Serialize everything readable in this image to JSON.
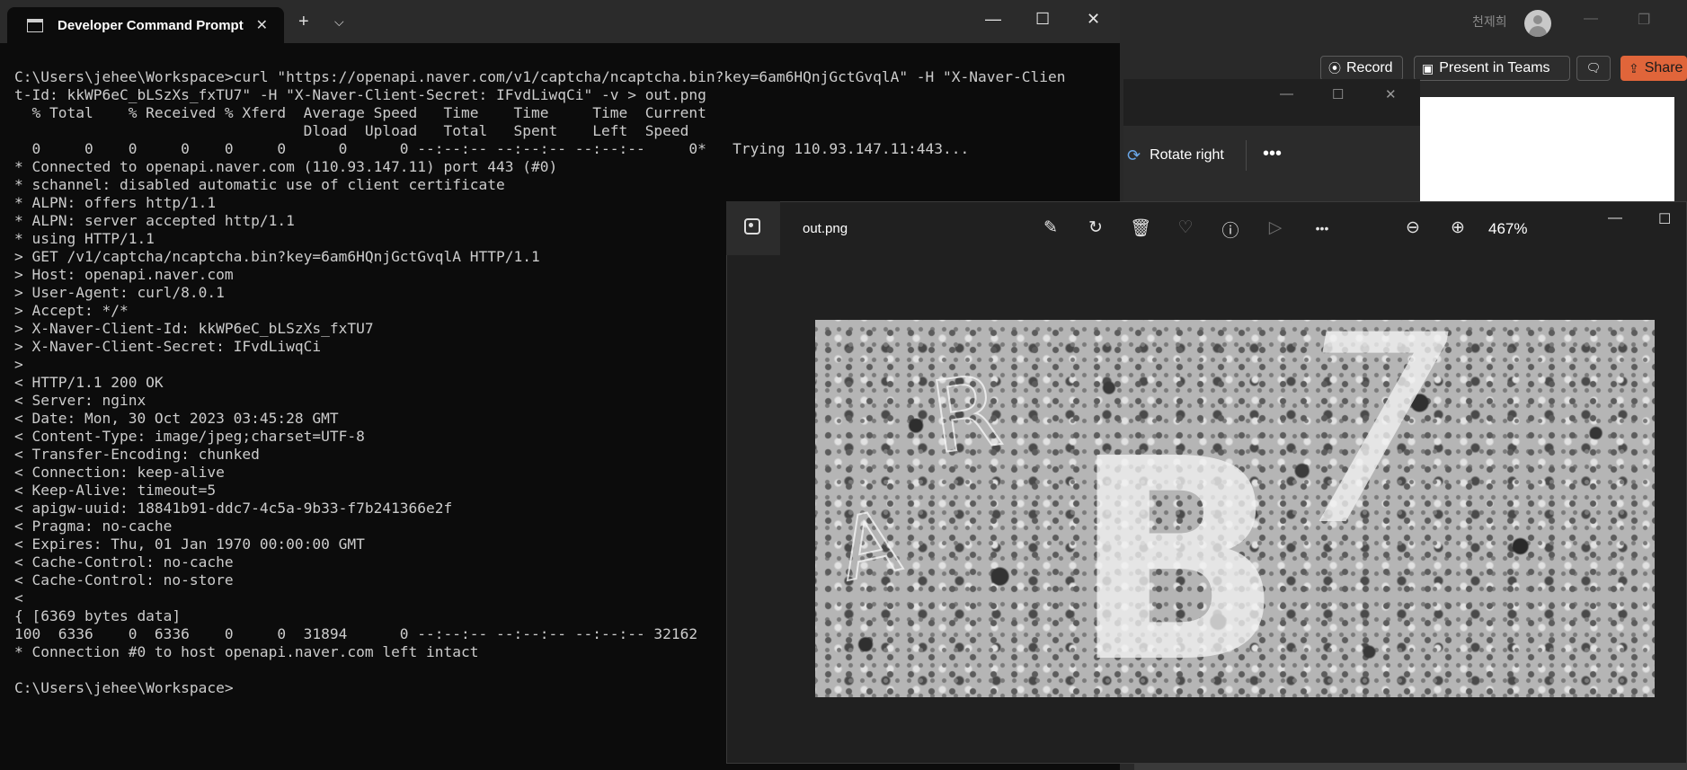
{
  "background_app": {
    "user_name": "천제희",
    "minimize_glyph": "—",
    "restore_glyph": "❐",
    "buttons": [
      {
        "icon": "record-icon",
        "glyph": "⦿",
        "label": "Record"
      },
      {
        "icon": "teams-present-icon",
        "glyph": "▣",
        "label": "Present in Teams"
      },
      {
        "icon": "comment-icon",
        "glyph": "🗨",
        "label": ""
      },
      {
        "icon": "share-icon",
        "glyph": "⇪",
        "label": "Share"
      }
    ]
  },
  "edit_window": {
    "rotate_label": "Rotate right",
    "rotate_glyph": "⟳",
    "more_glyph": "•••",
    "minimize_glyph": "—",
    "maximize_glyph": "☐",
    "close_glyph": "✕"
  },
  "terminal": {
    "tab_title": "Developer Command Prompt",
    "tab_close": "✕",
    "new_tab": "+",
    "dropdown": "⌵",
    "minimize_glyph": "—",
    "maximize_glyph": "☐",
    "close_glyph": "✕",
    "lines": [
      "C:\\Users\\jehee\\Workspace>curl \"https://openapi.naver.com/v1/captcha/ncaptcha.bin?key=6am6HQnjGctGvqlA\" -H \"X-Naver-Clien",
      "t-Id: kkWP6eC_bLSzXs_fxTU7\" -H \"X-Naver-Client-Secret: IFvdLiwqCi\" -v > out.png",
      "  % Total    % Received % Xferd  Average Speed   Time    Time     Time  Current",
      "                                 Dload  Upload   Total   Spent    Left  Speed",
      "  0     0    0     0    0     0      0      0 --:--:-- --:--:-- --:--:--     0*   Trying 110.93.147.11:443...",
      "* Connected to openapi.naver.com (110.93.147.11) port 443 (#0)",
      "* schannel: disabled automatic use of client certificate",
      "* ALPN: offers http/1.1",
      "* ALPN: server accepted http/1.1",
      "* using HTTP/1.1",
      "> GET /v1/captcha/ncaptcha.bin?key=6am6HQnjGctGvqlA HTTP/1.1",
      "> Host: openapi.naver.com",
      "> User-Agent: curl/8.0.1",
      "> Accept: */*",
      "> X-Naver-Client-Id: kkWP6eC_bLSzXs_fxTU7",
      "> X-Naver-Client-Secret: IFvdLiwqCi",
      ">",
      "< HTTP/1.1 200 OK",
      "< Server: nginx",
      "< Date: Mon, 30 Oct 2023 03:45:28 GMT",
      "< Content-Type: image/jpeg;charset=UTF-8",
      "< Transfer-Encoding: chunked",
      "< Connection: keep-alive",
      "< Keep-Alive: timeout=5",
      "< apigw-uuid: 18841b91-ddc7-4c5a-9b33-f7b241366e2f",
      "< Pragma: no-cache",
      "< Expires: Thu, 01 Jan 1970 00:00:00 GMT",
      "< Cache-Control: no-cache",
      "< Cache-Control: no-store",
      "<",
      "{ [6369 bytes data]",
      "100  6336    0  6336    0     0  31894      0 --:--:-- --:--:-- --:--:-- 32162",
      "* Connection #0 to host openapi.naver.com left intact",
      "",
      "C:\\Users\\jehee\\Workspace>"
    ]
  },
  "viewer": {
    "filename": "out.png",
    "zoom": "467%",
    "minimize_glyph": "—",
    "maximize_glyph": "☐",
    "tools": [
      {
        "name": "edit-image-icon",
        "glyph": "✎",
        "enabled": true
      },
      {
        "name": "rotate-icon",
        "glyph": "↻",
        "enabled": true
      },
      {
        "name": "delete-icon",
        "glyph": "🗑",
        "enabled": true
      },
      {
        "name": "favorite-icon",
        "glyph": "♡",
        "enabled": false
      },
      {
        "name": "info-icon",
        "glyph": "ⓘ",
        "enabled": true
      },
      {
        "name": "slideshow-icon",
        "glyph": "▷",
        "enabled": false
      },
      {
        "name": "more-icon",
        "glyph": "•••",
        "enabled": true
      },
      {
        "name": "zoom-out-icon",
        "glyph": "⊖",
        "enabled": true
      },
      {
        "name": "zoom-in-icon",
        "glyph": "⊕",
        "enabled": true
      }
    ],
    "captcha_glyphs": [
      {
        "text": "R",
        "style": "small"
      },
      {
        "text": "B",
        "style": "large"
      },
      {
        "text": "7",
        "style": "large"
      },
      {
        "text": "A",
        "style": "small"
      }
    ]
  }
}
